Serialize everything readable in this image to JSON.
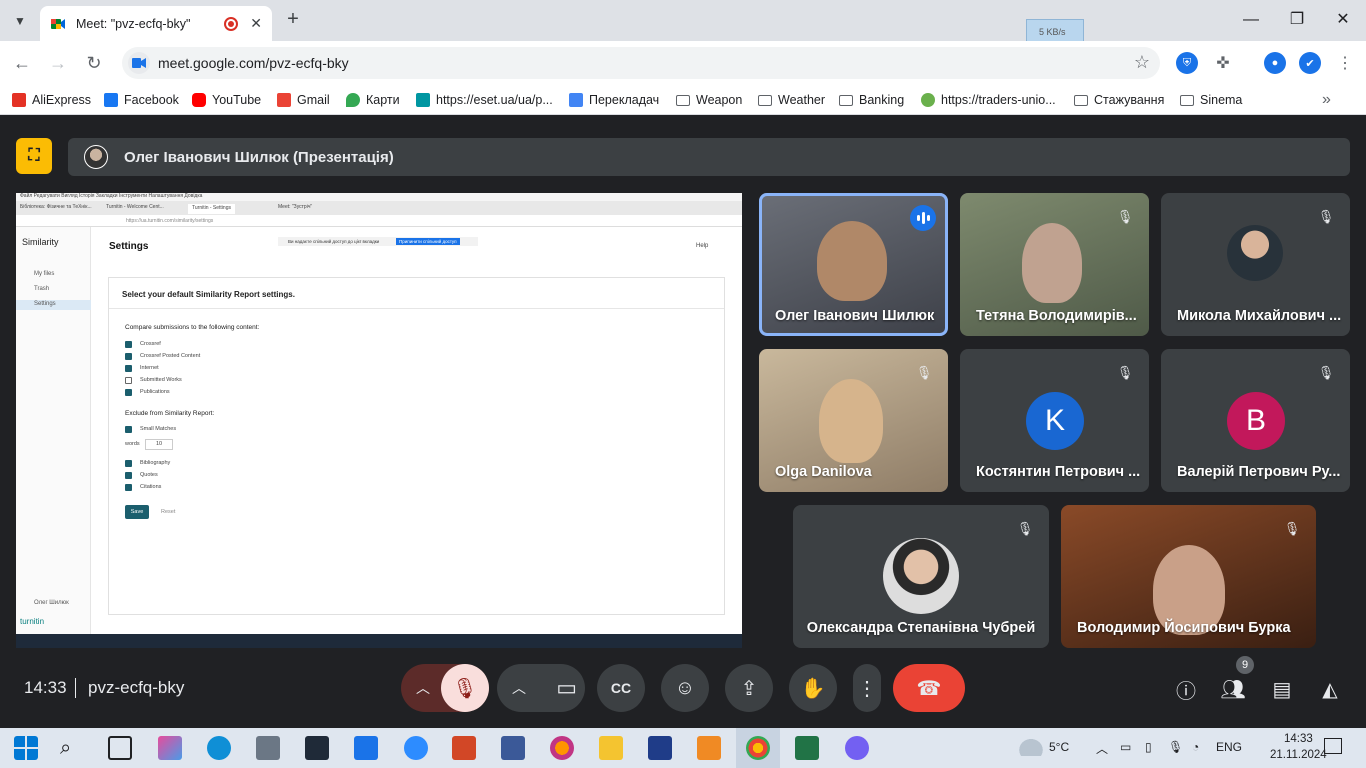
{
  "browser": {
    "tab_title": "Meet: \"pvz-ecfq-bky\"",
    "url": "meet.google.com/pvz-ecfq-bky",
    "net_widget": "5 KB/s",
    "bookmarks": [
      {
        "label": "AliExpress",
        "color": "#e43225"
      },
      {
        "label": "Facebook",
        "color": "#1877f2"
      },
      {
        "label": "YouTube",
        "color": "#ff0000"
      },
      {
        "label": "Gmail",
        "color": "#ea4335"
      },
      {
        "label": "Карти",
        "color": "#34a853"
      },
      {
        "label": "https://eset.ua/ua/p...",
        "color": "#0096a1"
      },
      {
        "label": "Перекладач",
        "color": "#4285f4"
      },
      {
        "label": "Weapon",
        "color": "folder"
      },
      {
        "label": "Weather",
        "color": "folder"
      },
      {
        "label": "Banking",
        "color": "folder"
      },
      {
        "label": "https://traders-unio...",
        "color": "#6ab04c"
      },
      {
        "label": "Стажування",
        "color": "folder"
      },
      {
        "label": "Sinema",
        "color": "folder"
      }
    ]
  },
  "meet": {
    "presenter_label": "Олег Іванович Шилюк (Презентація)",
    "time": "14:33",
    "meeting_code": "pvz-ecfq-bky",
    "participants_count": "9",
    "tiles": [
      {
        "name": "Олег Іванович Шилюк"
      },
      {
        "name": "Тетяна Володимирів..."
      },
      {
        "name": "Микола Михайлович ..."
      },
      {
        "name": "Olga Danilova"
      },
      {
        "name": "Костянтин Петрович ...",
        "initial": "K",
        "color": "#1967d2"
      },
      {
        "name": "Валерій Петрович Ру...",
        "initial": "B",
        "color": "#c2185b"
      },
      {
        "name": "Олександра Степанівна Чубрей"
      },
      {
        "name": "Володимир Йосипович Бурка"
      }
    ]
  },
  "shared_screen": {
    "sidebar_title": "Similarity",
    "sidebar_items": [
      "My files",
      "Trash",
      "Settings"
    ],
    "logo": "turnitin",
    "user_footer": "Олег Шилюк",
    "page_title": "Settings",
    "help": "Help",
    "banner_text": "Ви надаєте спільний доступ до цієї вкладки",
    "banner_button": "Припинити спільний доступ",
    "tabs": [
      "Бібліотека: Фізичне та ТеХнік...",
      "Turnitin - Welcome Cent...",
      "Turnitin - Settings",
      "Meet: \"Зустріч\""
    ],
    "card_title": "Select your default Similarity Report settings.",
    "compare_label": "Compare submissions to the following content:",
    "compare_items": [
      {
        "label": "Crossref",
        "checked": true
      },
      {
        "label": "Crossref Posted Content",
        "checked": true
      },
      {
        "label": "Internet",
        "checked": true
      },
      {
        "label": "Submitted Works",
        "checked": false
      },
      {
        "label": "Publications",
        "checked": true
      }
    ],
    "exclude_label": "Exclude from Similarity Report:",
    "small_matches": "Small Matches",
    "words_label": "words",
    "words_value": "10",
    "exclude_items": [
      "Bibliography",
      "Quotes",
      "Citations"
    ],
    "save": "Save",
    "reset": "Reset"
  },
  "os": {
    "weather": "5°C",
    "lang": "ENG",
    "clock_time": "14:33",
    "clock_date": "21.11.2024"
  }
}
